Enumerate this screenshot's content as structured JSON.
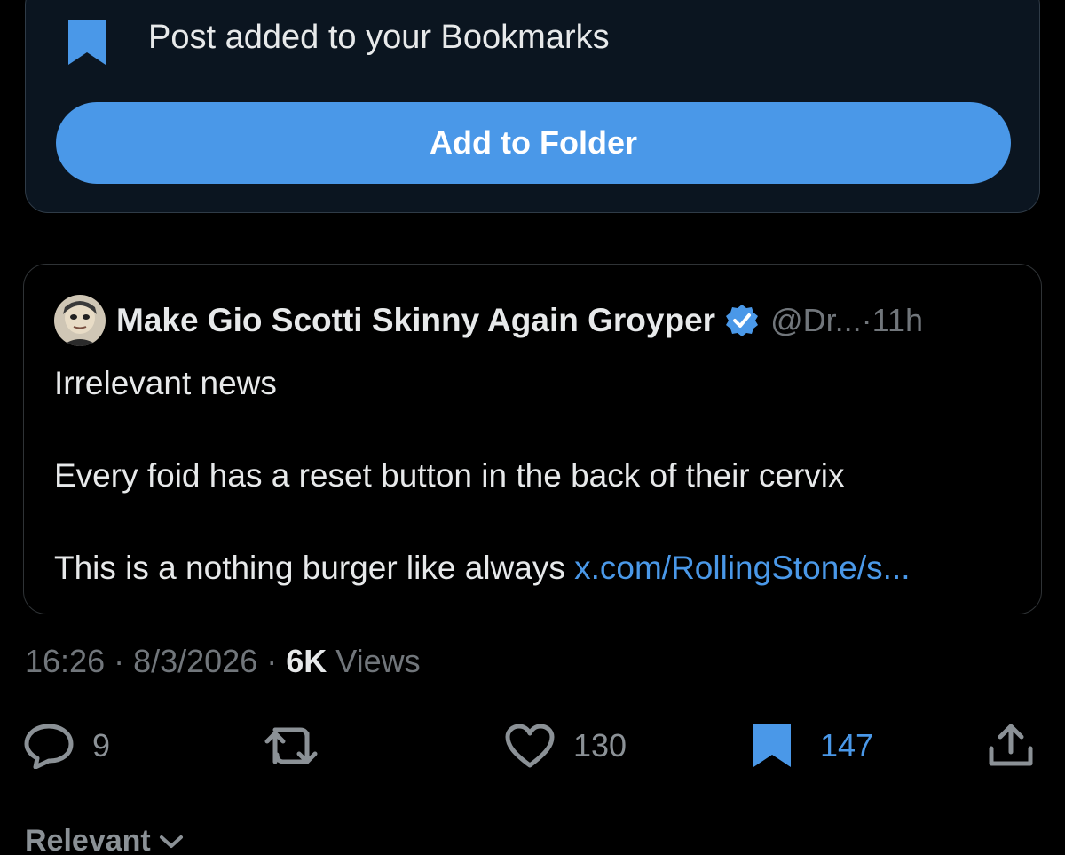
{
  "toast": {
    "message": "Post added to your Bookmarks",
    "button_label": "Add to Folder",
    "icon": "bookmark-icon"
  },
  "quoted_post": {
    "display_name": "Make Gio Scotti Skinny Again Groyper",
    "handle": "@Dr...",
    "separator": " · ",
    "time_ago": "11h",
    "lines": [
      "Irrelevant news",
      "Every foid has a reset button in the back of their cervix",
      "This is a nothing burger like always"
    ],
    "link_text": "x.com/RollingStone/s..."
  },
  "meta": {
    "time": "16:26",
    "sep1": " · ",
    "date": "8/3/2026",
    "sep2": " · ",
    "views_count": "6K",
    "views_label": " Views"
  },
  "actions": {
    "replies": "9",
    "likes": "130",
    "bookmarks": "147"
  },
  "sort": {
    "label": "Relevant"
  },
  "colors": {
    "accent": "#4a98e8",
    "background": "#000000",
    "toast_bg": "#0b1520",
    "muted": "#71767b"
  }
}
